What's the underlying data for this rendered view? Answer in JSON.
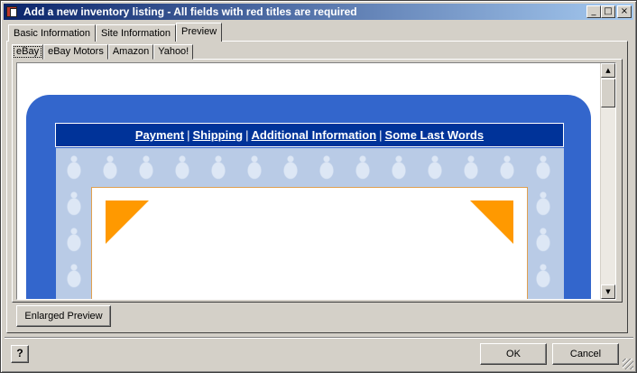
{
  "window": {
    "title": "Add a new inventory listing - All fields with red titles are required",
    "minimize_glyph": "_",
    "maximize_glyph": "□",
    "close_glyph": "×"
  },
  "tabs": [
    {
      "label": "Basic Information",
      "active": false
    },
    {
      "label": "Site Information",
      "active": false
    },
    {
      "label": "Preview",
      "active": true
    }
  ],
  "subtabs": [
    {
      "label": "eBay",
      "active": true
    },
    {
      "label": "eBay Motors",
      "active": false
    },
    {
      "label": "Amazon",
      "active": false
    },
    {
      "label": "Yahoo!",
      "active": false
    }
  ],
  "preview": {
    "nav_links": [
      "Payment",
      "Shipping",
      "Additional Information",
      "Some Last Words"
    ],
    "nav_separator": "|",
    "colors": {
      "frame": "#3366cc",
      "navbar": "#003399",
      "corner": "#ff9900",
      "pattern": "#b9cbe6"
    }
  },
  "scrollbar": {
    "up_glyph": "▲",
    "down_glyph": "▼"
  },
  "buttons": {
    "enlarged_preview": "Enlarged Preview",
    "help": "?",
    "ok": "OK",
    "cancel": "Cancel"
  }
}
